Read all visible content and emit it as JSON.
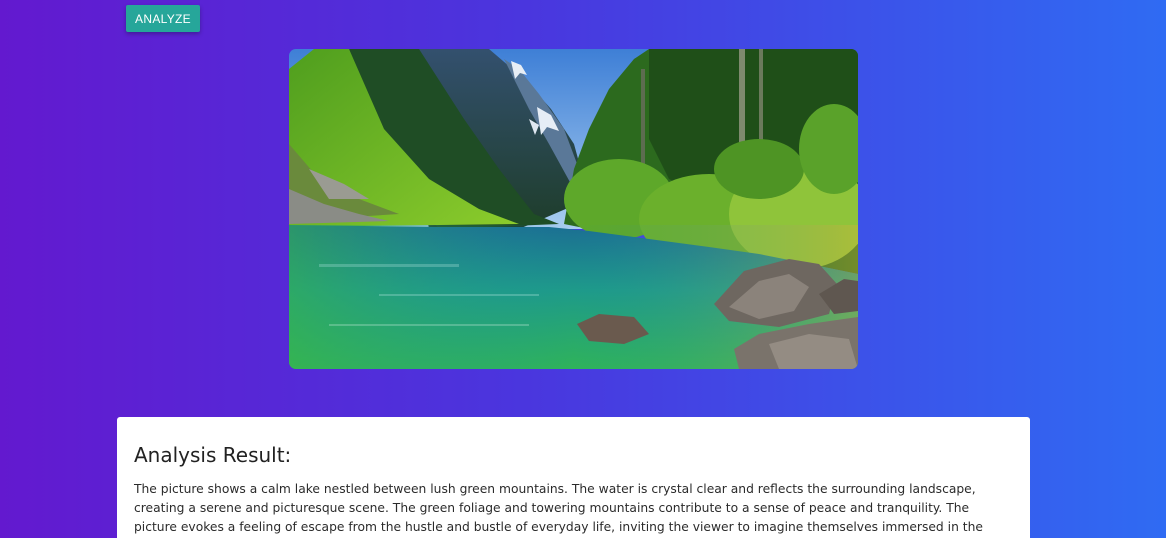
{
  "toolbar": {
    "analyze_label": "ANALYZE"
  },
  "preview": {
    "image_alt": "mountain lake landscape"
  },
  "result": {
    "title": "Analysis Result:",
    "text": "The picture shows a calm lake nestled between lush green mountains. The water is crystal clear and reflects the surrounding landscape, creating a serene and picturesque scene. The green foliage and towering mountains contribute to a sense of peace and tranquility. The picture evokes a feeling of escape from the hustle and bustle of everyday life, inviting the viewer to imagine themselves immersed in the beauty of nature."
  },
  "colors": {
    "accent": "#26a69a",
    "background_start": "#6319cf",
    "background_end": "#2f6bf3"
  }
}
